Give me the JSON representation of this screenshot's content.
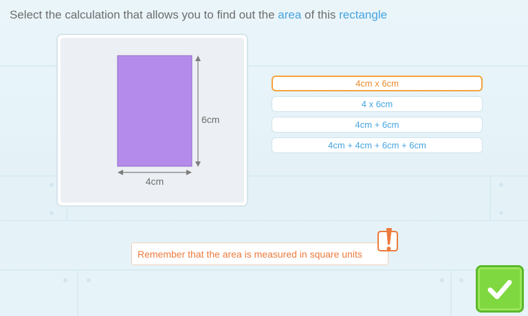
{
  "question": {
    "part1": "Select the calculation that allows you to find out the ",
    "keyword1": "area",
    "part2": " of this ",
    "keyword2": "rectangle"
  },
  "figure": {
    "height_label": "6cm",
    "width_label": "4cm",
    "rect_color": "#b48bea"
  },
  "options": [
    {
      "label": "4cm x 6cm",
      "selected": true
    },
    {
      "label": "4 x 6cm",
      "selected": false
    },
    {
      "label": "4cm + 6cm",
      "selected": false
    },
    {
      "label": "4cm + 4cm + 6cm + 6cm",
      "selected": false
    }
  ],
  "hint": {
    "text": "Remember that the area is measured in square units",
    "icon": "exclamation-icon"
  },
  "submit": {
    "icon": "checkmark-icon",
    "color": "#7fd83f"
  },
  "colors": {
    "accent": "#45a3e0",
    "selected_border": "#f5a33b",
    "hint_text": "#ec7a3c"
  }
}
